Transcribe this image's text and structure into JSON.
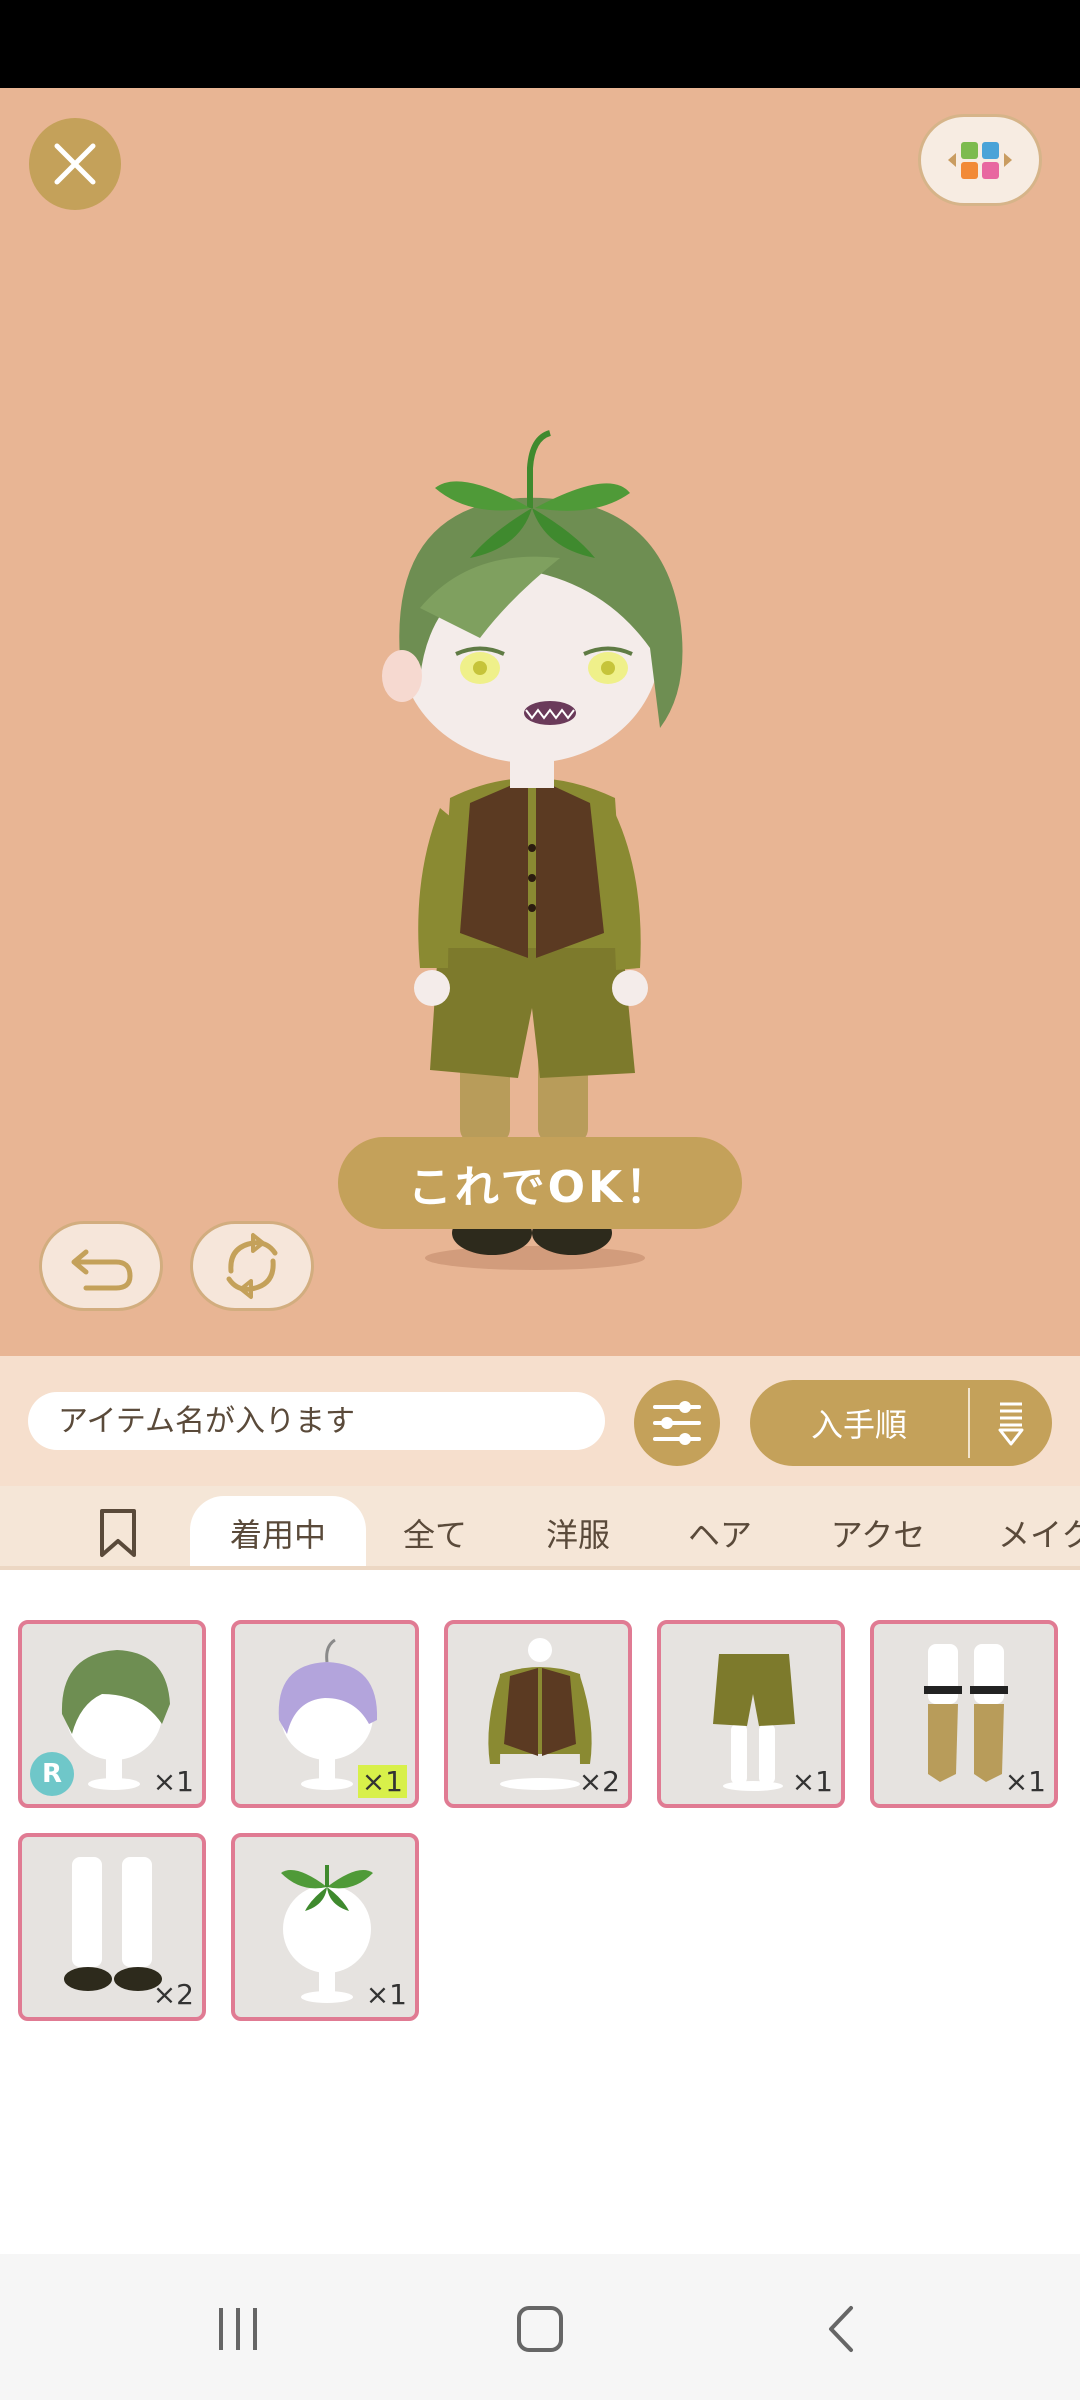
{
  "editor": {
    "ok_label": "これでOK！"
  },
  "search": {
    "placeholder": "アイテム名が入ります"
  },
  "sort": {
    "label": "入手順"
  },
  "tabs": [
    {
      "label": "着用中"
    },
    {
      "label": "全て"
    },
    {
      "label": "洋服"
    },
    {
      "label": "ヘア"
    },
    {
      "label": "アクセ"
    },
    {
      "label": "メイク"
    }
  ],
  "items": [
    {
      "icon": "green-hair-icon",
      "qty": "×1",
      "rarity": "R"
    },
    {
      "icon": "purple-hair-icon",
      "qty": "×1"
    },
    {
      "icon": "vest-top-icon",
      "qty": "×2"
    },
    {
      "icon": "shorts-icon",
      "qty": "×1"
    },
    {
      "icon": "garter-socks-icon",
      "qty": "×1"
    },
    {
      "icon": "tights-shoes-icon",
      "qty": "×2"
    },
    {
      "icon": "leaf-hat-icon",
      "qty": "×1"
    }
  ],
  "colors": {
    "stage_bg": "#e8b594",
    "accent": "#c4a15a",
    "card_border": "#e07b93"
  }
}
